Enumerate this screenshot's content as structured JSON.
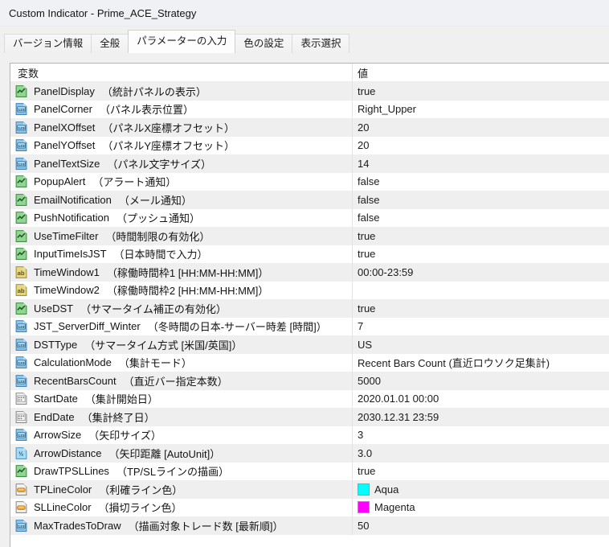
{
  "window": {
    "title": "Custom Indicator - Prime_ACE_Strategy"
  },
  "tabs": [
    {
      "id": "version",
      "label": "バージョン情報",
      "active": false
    },
    {
      "id": "common",
      "label": "全般",
      "active": false
    },
    {
      "id": "parameters",
      "label": "パラメーターの入力",
      "active": true
    },
    {
      "id": "colors",
      "label": "色の設定",
      "active": false
    },
    {
      "id": "display",
      "label": "表示選択",
      "active": false
    }
  ],
  "table": {
    "headers": {
      "variable": "変数",
      "value": "値"
    },
    "icon_names": {
      "bool": "boolean-param-icon",
      "int": "integer-param-icon",
      "str": "string-param-icon",
      "date": "datetime-param-icon",
      "double": "double-param-icon",
      "color": "color-param-icon"
    },
    "rows": [
      {
        "icon": "bool",
        "name": "PanelDisplay",
        "desc": "（統計パネルの表示）",
        "value": "true"
      },
      {
        "icon": "int",
        "name": "PanelCorner",
        "desc": "（パネル表示位置）",
        "value": "Right_Upper"
      },
      {
        "icon": "int",
        "name": "PanelXOffset",
        "desc": "（パネルX座標オフセット）",
        "value": "20"
      },
      {
        "icon": "int",
        "name": "PanelYOffset",
        "desc": "（パネルY座標オフセット）",
        "value": "20"
      },
      {
        "icon": "int",
        "name": "PanelTextSize",
        "desc": "（パネル文字サイズ）",
        "value": "14"
      },
      {
        "icon": "bool",
        "name": "PopupAlert",
        "desc": "（アラート通知）",
        "value": "false"
      },
      {
        "icon": "bool",
        "name": "EmailNotification",
        "desc": "（メール通知）",
        "value": "false"
      },
      {
        "icon": "bool",
        "name": "PushNotification",
        "desc": "（プッシュ通知）",
        "value": "false"
      },
      {
        "icon": "bool",
        "name": "UseTimeFilter",
        "desc": "（時間制限の有効化）",
        "value": "true"
      },
      {
        "icon": "bool",
        "name": "InputTimeIsJST",
        "desc": "（日本時間で入力）",
        "value": "true"
      },
      {
        "icon": "str",
        "name": "TimeWindow1",
        "desc": "（稼働時間枠1 [HH:MM-HH:MM]）",
        "value": "00:00-23:59"
      },
      {
        "icon": "str",
        "name": "TimeWindow2",
        "desc": "（稼働時間枠2 [HH:MM-HH:MM]）",
        "value": ""
      },
      {
        "icon": "bool",
        "name": "UseDST",
        "desc": "（サマータイム補正の有効化）",
        "value": "true"
      },
      {
        "icon": "int",
        "name": "JST_ServerDiff_Winter",
        "desc": "（冬時間の日本-サーバー時差 [時間]）",
        "value": "7"
      },
      {
        "icon": "int",
        "name": "DSTType",
        "desc": "（サマータイム方式 [米国/英国]）",
        "value": "US"
      },
      {
        "icon": "int",
        "name": "CalculationMode",
        "desc": "（集計モード）",
        "value": "Recent Bars Count (直近ロウソク足集計)"
      },
      {
        "icon": "int",
        "name": "RecentBarsCount",
        "desc": "（直近バー指定本数）",
        "value": "5000"
      },
      {
        "icon": "date",
        "name": "StartDate",
        "desc": "（集計開始日）",
        "value": "2020.01.01 00:00"
      },
      {
        "icon": "date",
        "name": "EndDate",
        "desc": "（集計終了日）",
        "value": "2030.12.31 23:59"
      },
      {
        "icon": "int",
        "name": "ArrowSize",
        "desc": "（矢印サイズ）",
        "value": "3"
      },
      {
        "icon": "double",
        "name": "ArrowDistance",
        "desc": "（矢印距離 [AutoUnit]）",
        "value": "3.0"
      },
      {
        "icon": "bool",
        "name": "DrawTPSLLines",
        "desc": "（TP/SLラインの描画）",
        "value": "true"
      },
      {
        "icon": "color",
        "name": "TPLineColor",
        "desc": "（利確ライン色）",
        "value": "Aqua",
        "swatch": "#00FFFF"
      },
      {
        "icon": "color",
        "name": "SLLineColor",
        "desc": "（損切ライン色）",
        "value": "Magenta",
        "swatch": "#FF00FF"
      },
      {
        "icon": "int",
        "name": "MaxTradesToDraw",
        "desc": "（描画対象トレード数 [最新順]）",
        "value": "50"
      }
    ]
  },
  "colors": {
    "aqua": "#00FFFF",
    "magenta": "#FF00FF",
    "row_alternate": "#efefef",
    "titlebar": "#eff1f5"
  }
}
